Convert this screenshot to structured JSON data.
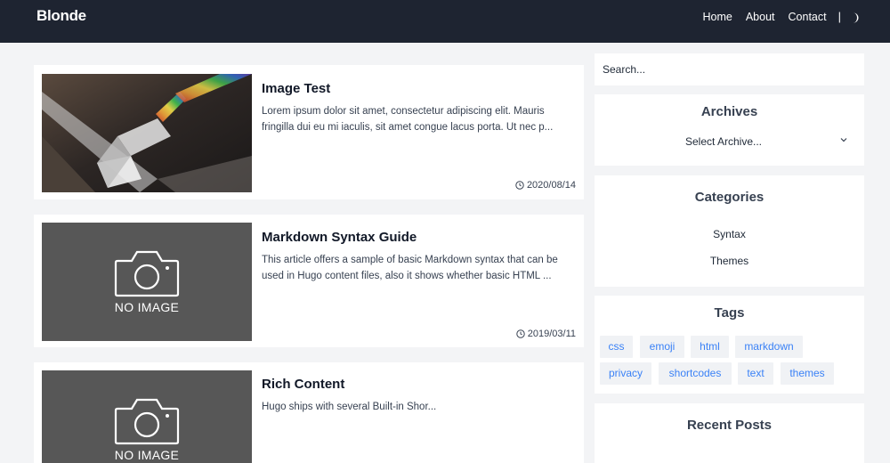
{
  "site": {
    "brand": "Blonde"
  },
  "nav": {
    "items": [
      "Home",
      "About",
      "Contact"
    ],
    "separator": "|",
    "theme_icon": "moon-icon"
  },
  "posts": [
    {
      "title": "Image Test",
      "excerpt": "Lorem ipsum dolor sit amet, consectetur adipiscing elit. Mauris fringilla dui eu mi iaculis, sit amet congue lacus porta. Ut nec p...",
      "date": "2020/08/14",
      "image": "prism-photo"
    },
    {
      "title": "Markdown Syntax Guide",
      "excerpt": "This article offers a sample of basic Markdown syntax that can be used in Hugo content files, also it shows whether basic HTML ...",
      "date": "2019/03/11",
      "image": "no-image",
      "image_label": "NO IMAGE"
    },
    {
      "title": "Rich Content",
      "excerpt": "Hugo ships with several Built-in Shor...",
      "image": "no-image",
      "image_label": "NO IMAGE"
    }
  ],
  "sidebar": {
    "search": {
      "placeholder": "Search..."
    },
    "archives": {
      "title": "Archives",
      "select_value": "Select Archive..."
    },
    "categories": {
      "title": "Categories",
      "items": [
        "Syntax",
        "Themes"
      ]
    },
    "tags": {
      "title": "Tags",
      "items": [
        "css",
        "emoji",
        "html",
        "markdown",
        "privacy",
        "shortcodes",
        "text",
        "themes"
      ]
    },
    "recent_posts": {
      "title": "Recent Posts"
    }
  },
  "colors": {
    "navbar": "#1e2431",
    "background": "#f3f4f6",
    "tag_text": "#3b82f6",
    "tag_bg": "#f0f2f5",
    "no_image_bg": "#575757"
  }
}
